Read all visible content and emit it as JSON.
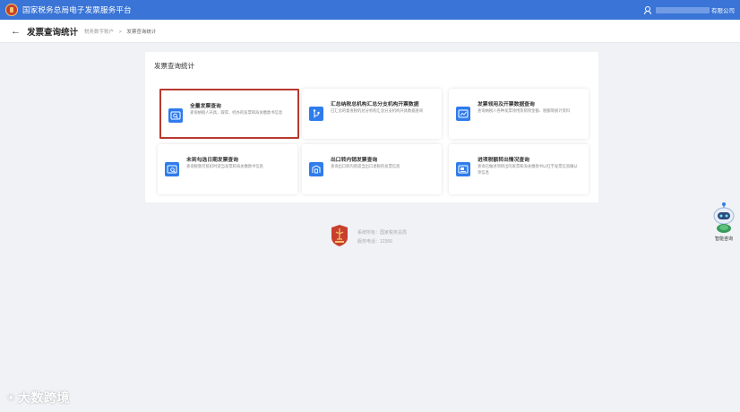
{
  "app": {
    "title": "国家税务总局电子发票服务平台",
    "user_suffix": "有限公司"
  },
  "page": {
    "title": "发票查询统计",
    "breadcrumb": [
      "税务数字账户",
      "发票查询统计"
    ]
  },
  "panel": {
    "title": "发票查询统计",
    "cards": [
      {
        "title": "全量发票查询",
        "desc": "查询纳税人开具、取得、经办的发票和海关缴款书信息",
        "icon": "search-icon",
        "selected": true
      },
      {
        "title": "汇总纳税总机构汇总分支机构开票数据",
        "desc": "已汇总的督查税的总分机构汇总分支机构开具数据查询",
        "icon": "branch-icon",
        "selected": false
      },
      {
        "title": "发票领用及开票数据查询",
        "desc": "查询纳税人各种发票领用及销项金额、税额等统计资料",
        "icon": "chart-icon",
        "selected": false
      },
      {
        "title": "未到勾选日期发票查询",
        "desc": "查询税款可抵扣时适当发票和海关缴款书信息",
        "icon": "calendar-search-icon",
        "selected": false
      },
      {
        "title": "出口转内销发票查询",
        "desc": "查询出口转内销适当出口退税的发票信息",
        "icon": "export-icon",
        "selected": false
      },
      {
        "title": "进项税额转出情况查询",
        "desc": "查询已做进项转出的发票和海关缴款书以红字发票信息确认单信息",
        "icon": "transfer-out-icon",
        "selected": false
      }
    ]
  },
  "footer": {
    "lines": [
      "系统所有：国家税务总局",
      "服务电话：12366"
    ]
  },
  "assistant": {
    "label": "智能咨询",
    "icon": "robot-icon"
  },
  "watermark": {
    "text": "大数跨境"
  },
  "colors": {
    "header": "#3a74d6",
    "icon_bg": "#2f7cec",
    "highlight": "#b8392f",
    "background": "#f0f2f5"
  }
}
